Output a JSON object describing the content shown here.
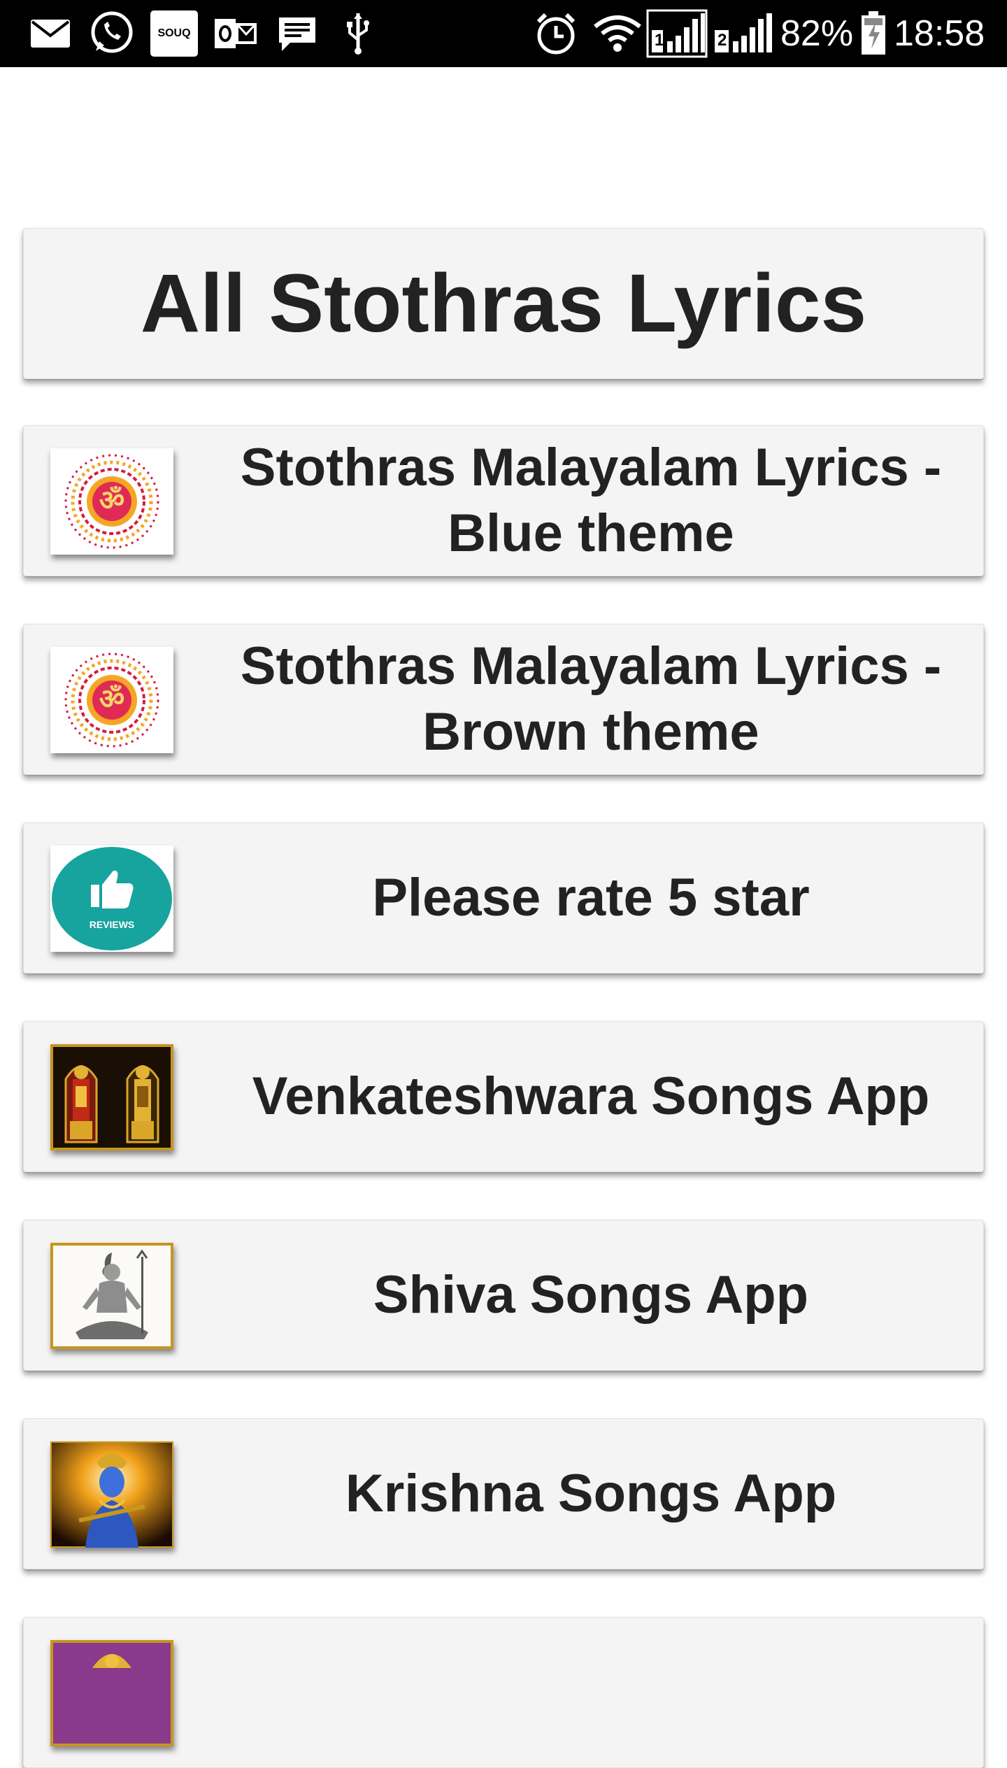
{
  "status_bar": {
    "battery_percent": "82%",
    "time": "18:58",
    "souq_label": "SOUQ",
    "sim1": "1",
    "sim2": "2",
    "left_icons": [
      "mail-icon",
      "whatsapp-icon",
      "souq-icon",
      "outlook-icon",
      "message-icon",
      "usb-icon"
    ],
    "right_icons": [
      "alarm-icon",
      "wifi-icon",
      "signal-sim1-icon",
      "signal-sim2-icon",
      "battery-charging-icon"
    ]
  },
  "header": {
    "title": "All Stothras Lyrics"
  },
  "items": [
    {
      "label": "Stothras Malayalam Lyrics - Blue theme",
      "icon": "om-mandala-icon"
    },
    {
      "label": "Stothras Malayalam Lyrics - Brown theme",
      "icon": "om-mandala-icon"
    },
    {
      "label": "Please rate 5 star",
      "icon": "reviews-thumbs-up-icon",
      "icon_text": "REVIEWS"
    },
    {
      "label": "Venkateshwara Songs App",
      "icon": "venkateshwara-image-icon"
    },
    {
      "label": "Shiva Songs App",
      "icon": "shiva-image-icon"
    },
    {
      "label": "Krishna Songs App",
      "icon": "krishna-image-icon"
    },
    {
      "label": "",
      "icon": "deity-image-icon"
    }
  ],
  "colors": {
    "status_bar_bg": "#000000",
    "card_bg": "#f4f4f4",
    "text": "#222222",
    "reviews_teal": "#17a39e",
    "om_red": "#d81b3c",
    "om_orange": "#f5a623",
    "frame_gold": "#c8961e"
  }
}
